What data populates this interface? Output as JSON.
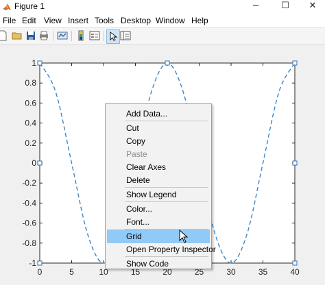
{
  "window": {
    "title": "Figure 1",
    "minimize": "─",
    "maximize": "☐",
    "close": "✕"
  },
  "menubar": [
    "File",
    "Edit",
    "View",
    "Insert",
    "Tools",
    "Desktop",
    "Window",
    "Help"
  ],
  "toolbar_icons": [
    "new-figure-icon",
    "open-file-icon",
    "save-icon",
    "print-icon",
    "link-plot-icon",
    "colorbar-icon",
    "legend-icon",
    "select-pointer-icon",
    "property-editor-icon"
  ],
  "context_menu": {
    "items": [
      {
        "label": "Add Data...",
        "enabled": true,
        "highlighted": false
      },
      {
        "label": "Cut",
        "enabled": true,
        "highlighted": false
      },
      {
        "label": "Copy",
        "enabled": true,
        "highlighted": false
      },
      {
        "label": "Paste",
        "enabled": false,
        "highlighted": false
      },
      {
        "label": "Clear Axes",
        "enabled": true,
        "highlighted": false
      },
      {
        "label": "Delete",
        "enabled": true,
        "highlighted": false
      },
      {
        "label": "Show Legend",
        "enabled": true,
        "highlighted": false
      },
      {
        "label": "Color...",
        "enabled": true,
        "highlighted": false
      },
      {
        "label": "Font...",
        "enabled": true,
        "highlighted": false
      },
      {
        "label": "Grid",
        "enabled": true,
        "highlighted": true
      },
      {
        "label": "Open Property Inspector",
        "enabled": true,
        "highlighted": false
      },
      {
        "label": "Show Code",
        "enabled": true,
        "highlighted": false
      }
    ]
  },
  "colors": {
    "line": "#3a86c8",
    "highlight": "#91c9f7",
    "toolbar_bg": "#f5f5f5",
    "figure_bg": "#f0f0f0"
  },
  "chart_data": {
    "type": "line",
    "title": "",
    "xlabel": "",
    "ylabel": "",
    "xlim": [
      0,
      40
    ],
    "ylim": [
      -1,
      1
    ],
    "xticks": [
      "0",
      "5",
      "10",
      "15",
      "20",
      "25",
      "30",
      "35",
      "40"
    ],
    "yticks": [
      "1",
      "0.8",
      "0.6",
      "0.4",
      "0.2",
      "0",
      "-0.2",
      "-0.4",
      "-0.6",
      "-0.8",
      "-1"
    ],
    "grid": false,
    "line_style": "dashed",
    "series": [
      {
        "x": [
          0,
          2.5,
          5,
          7.5,
          10,
          12.5,
          15,
          17.5,
          20,
          22.5,
          25,
          27.5,
          30,
          32.5,
          35,
          37.5,
          40
        ],
        "y": [
          1,
          0.71,
          0,
          -0.71,
          -1,
          -0.71,
          0,
          0.71,
          1,
          0.71,
          0,
          -0.71,
          -1,
          -0.71,
          0,
          0.71,
          1
        ]
      }
    ]
  }
}
